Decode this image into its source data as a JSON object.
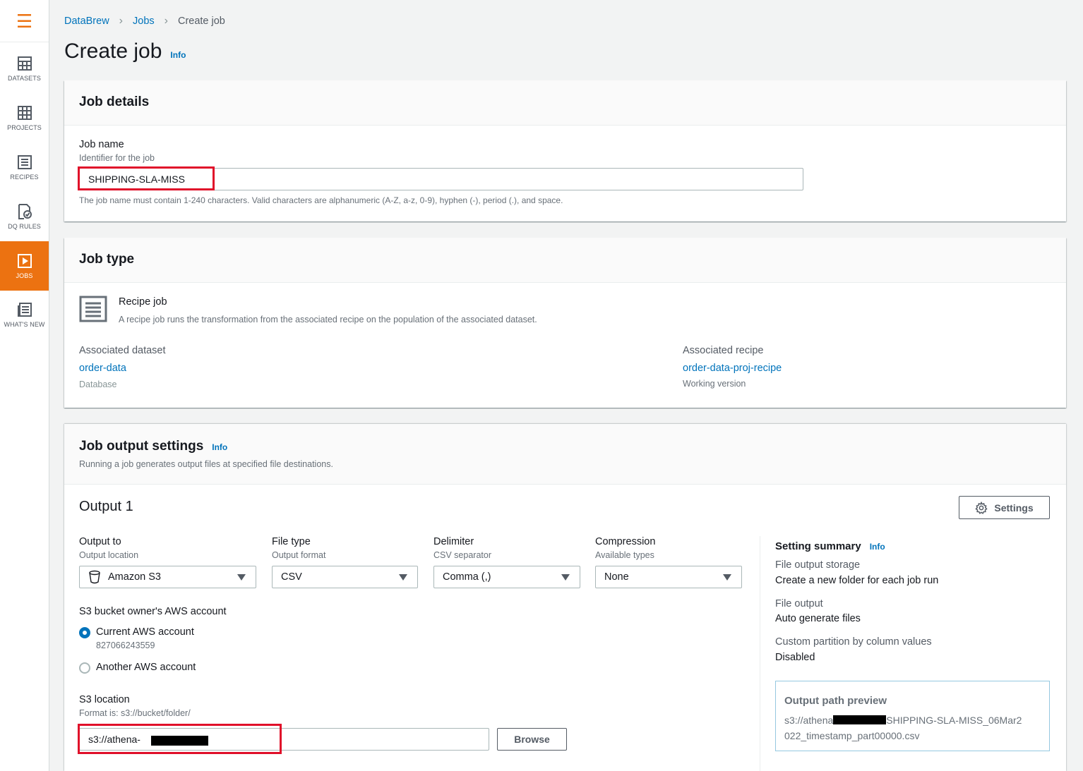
{
  "sidebar": {
    "menu_icon": "hamburger-menu-icon",
    "items": [
      {
        "label": "DATASETS",
        "icon": "table-icon"
      },
      {
        "label": "PROJECTS",
        "icon": "grid-icon"
      },
      {
        "label": "RECIPES",
        "icon": "recipe-list-icon"
      },
      {
        "label": "DQ RULES",
        "icon": "dq-rules-icon"
      },
      {
        "label": "JOBS",
        "icon": "play-icon",
        "active": true
      },
      {
        "label": "WHAT'S NEW",
        "icon": "news-icon"
      }
    ]
  },
  "breadcrumb": {
    "items": [
      "DataBrew",
      "Jobs",
      "Create job"
    ]
  },
  "page": {
    "title": "Create job",
    "info": "Info"
  },
  "job_details": {
    "title": "Job details",
    "job_name_label": "Job name",
    "job_name_desc": "Identifier for the job",
    "job_name_value": "SHIPPING-SLA-MISS",
    "constraint": "The job name must contain 1-240 characters. Valid characters are alphanumeric (A-Z, a-z, 0-9), hyphen (-), period (.), and space."
  },
  "job_type": {
    "title": "Job type",
    "recipe_job_title": "Recipe job",
    "recipe_job_desc": "A recipe job runs the transformation from the associated recipe on the population of the associated dataset.",
    "dataset_label": "Associated dataset",
    "dataset_value": "order-data",
    "dataset_sub": "Database",
    "recipe_label": "Associated recipe",
    "recipe_value": "order-data-proj-recipe",
    "recipe_sub": "Working version"
  },
  "output_settings": {
    "title": "Job output settings",
    "info": "Info",
    "desc": "Running a job generates output files at specified file destinations.",
    "output_title": "Output 1",
    "settings_button": "Settings",
    "output_to": {
      "label": "Output to",
      "desc": "Output location",
      "value": "Amazon S3"
    },
    "file_type": {
      "label": "File type",
      "desc": "Output format",
      "value": "CSV"
    },
    "delimiter": {
      "label": "Delimiter",
      "desc": "CSV separator",
      "value": "Comma (,)"
    },
    "compression": {
      "label": "Compression",
      "desc": "Available types",
      "value": "None"
    },
    "bucket_owner_label": "S3 bucket owner's AWS account",
    "radio_current": "Current AWS account",
    "radio_current_id": "827066243559",
    "radio_another": "Another AWS account",
    "s3_location_label": "S3 location",
    "s3_location_desc": "Format is: s3://bucket/folder/",
    "s3_location_value": "s3://athena-",
    "browse_button": "Browse",
    "summary": {
      "title": "Setting summary",
      "info": "Info",
      "storage_label": "File output storage",
      "storage_value": "Create a new folder for each job run",
      "file_output_label": "File output",
      "file_output_value": "Auto generate files",
      "partition_label": "Custom partition by column values",
      "partition_value": "Disabled",
      "preview_title": "Output path preview",
      "preview_prefix": "s3://athena",
      "preview_line1_rest": "SHIPPING-SLA-MISS_06Mar2",
      "preview_line2": "022_timestamp_part00000.csv"
    }
  }
}
